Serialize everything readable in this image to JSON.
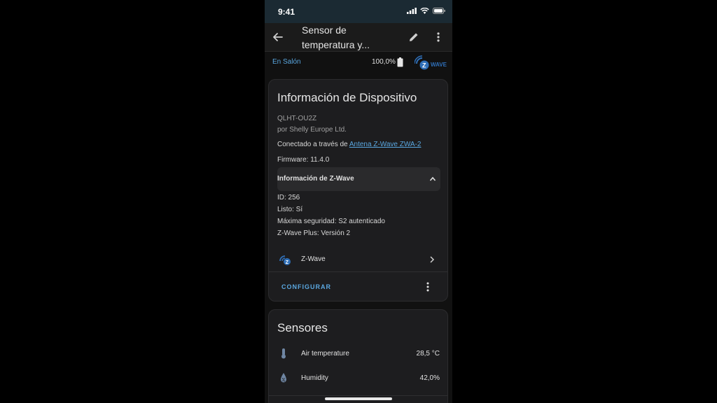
{
  "status_bar": {
    "time": "9:41"
  },
  "app_bar": {
    "title_line1": "Sensor de",
    "title_line2": "temperatura y..."
  },
  "info_bar": {
    "area": "En Salón",
    "battery": "100,0%",
    "logo_text": "WAVE"
  },
  "device_card": {
    "title": "Información de Dispositivo",
    "model": "QLHT-OU2Z",
    "manufacturer": "por Shelly Europe Ltd.",
    "connected_prefix": "Conectado a través de ",
    "connected_link": "Antena Z-Wave ZWA-2",
    "firmware": "Firmware: 11.4.0",
    "zwave_section": {
      "label": "Información de Z-Wave",
      "id": "ID: 256",
      "ready": "Listo: Sí",
      "security": "Máxima seguridad: S2 autenticado",
      "plus": "Z-Wave Plus: Versión 2"
    },
    "integration_label": "Z-Wave",
    "configure_label": "CONFIGURAR"
  },
  "sensors_card": {
    "title": "Sensores",
    "items": [
      {
        "label": "Air temperature",
        "value": "28,5 °C",
        "icon": "thermometer-icon"
      },
      {
        "label": "Humidity",
        "value": "42,0%",
        "icon": "water-percent-icon"
      }
    ]
  },
  "colors": {
    "accent": "#5aa7e0",
    "background": "#111111",
    "card": "#1d1d1f",
    "status_bar": "#1b2a33"
  }
}
